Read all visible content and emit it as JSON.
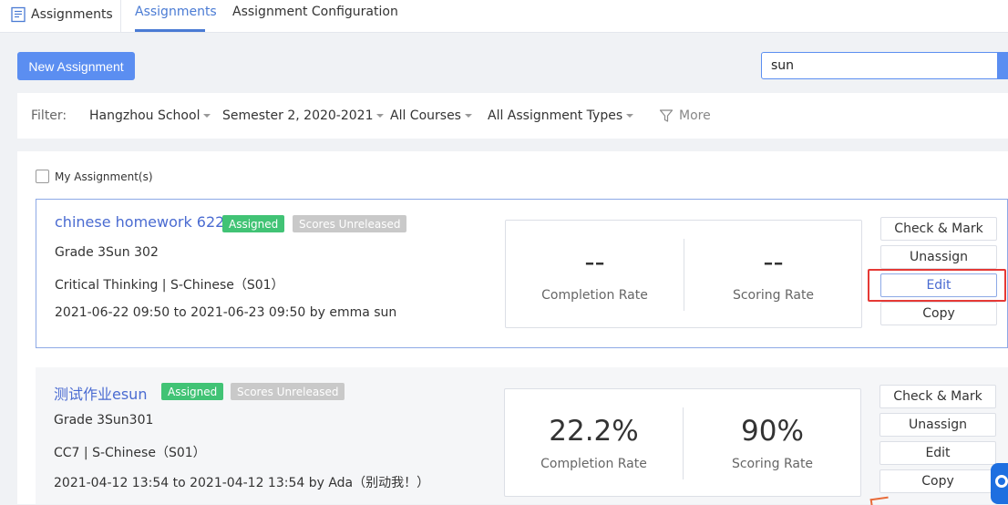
{
  "topbar": {
    "title": "Assignments",
    "tabs": [
      {
        "label": "Assignments",
        "active": true
      },
      {
        "label": "Assignment Configuration",
        "active": false
      }
    ]
  },
  "actions": {
    "new_label": "New Assignment",
    "search_value": "sun"
  },
  "filter": {
    "label": "Filter:",
    "school": "Hangzhou School",
    "semester": "Semester 2, 2020-2021",
    "courses": "All Courses",
    "types": "All Assignment Types",
    "more": "More"
  },
  "mine_label": "My Assignment(s)",
  "assignments": [
    {
      "name": "chinese homework 622",
      "status": "Assigned",
      "scores": "Scores Unreleased",
      "grade": "Grade 3Sun 302",
      "course": "Critical Thinking | S-Chinese（S01）",
      "time": "2021-06-22 09:50 to 2021-06-23 09:50 by emma sun",
      "completion": "--",
      "scoring": "--",
      "completion_label": "Completion Rate",
      "scoring_label": "Scoring Rate"
    },
    {
      "name": "测试作业esun",
      "status": "Assigned",
      "scores": "Scores Unreleased",
      "grade": "Grade 3Sun301",
      "course": "CC7 | S-Chinese（S01）",
      "time": "2021-04-12 13:54 to 2021-04-12 13:54 by Ada（别动我！）",
      "completion": "22.2%",
      "scoring": "90%",
      "completion_label": "Completion Rate",
      "scoring_label": "Scoring Rate"
    }
  ],
  "buttons": {
    "check": "Check & Mark",
    "unassign": "Unassign",
    "edit": "Edit",
    "copy": "Copy"
  },
  "colors": {
    "accent": "#5b8ef1",
    "assigned": "#41c375",
    "unreleased": "#c9c9c9",
    "highlight": "#e53935"
  }
}
